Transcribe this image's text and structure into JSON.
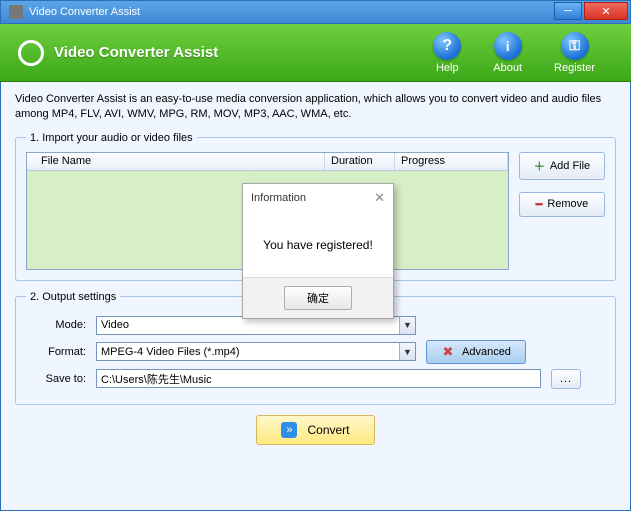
{
  "window": {
    "title": "Video Converter Assist"
  },
  "header": {
    "appname": "Video Converter Assist",
    "help": "Help",
    "about": "About",
    "register": "Register"
  },
  "desc": "Video Converter Assist is an easy-to-use media conversion application, which allows you to convert video and audio files among MP4, FLV, AVI, WMV, MPG, RM, MOV, MP3, AAC, WMA, etc.",
  "section1": {
    "legend": "1. Import your audio or video files",
    "col_name": "File Name",
    "col_duration": "Duration",
    "col_progress": "Progress",
    "add": "Add File",
    "remove": "Remove"
  },
  "section2": {
    "legend": "2. Output settings",
    "mode_label": "Mode:",
    "mode_value": "Video",
    "format_label": "Format:",
    "format_value": "MPEG-4 Video Files (*.mp4)",
    "advanced": "Advanced",
    "save_label": "Save to:",
    "save_path": "C:\\Users\\陈先生\\Music",
    "browse": "..."
  },
  "convert": "Convert",
  "dialog": {
    "title": "Information",
    "body": "You have registered!",
    "ok": "确定"
  }
}
